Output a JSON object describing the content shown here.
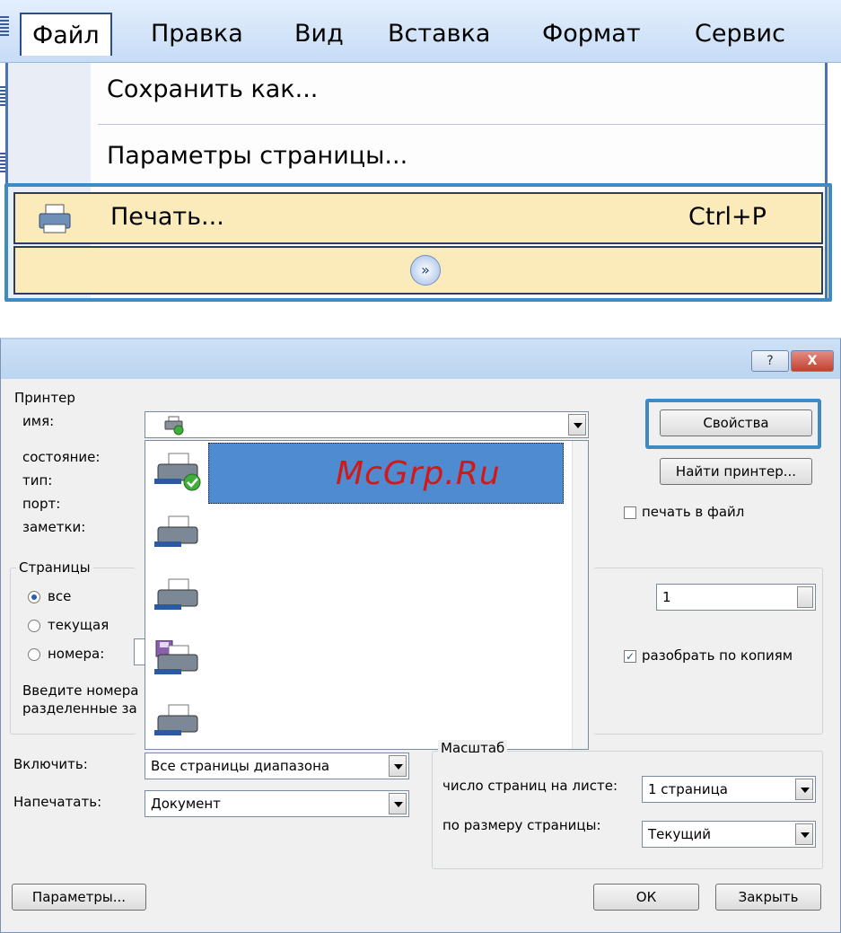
{
  "menu": {
    "items": [
      "Файл",
      "Правка",
      "Вид",
      "Вставка",
      "Формат",
      "Сервис"
    ],
    "dropdown": {
      "save_as": "Сохранить как...",
      "page_setup": "Параметры страницы...",
      "print": "Печать...",
      "print_shortcut": "Ctrl+P",
      "expand": "»"
    }
  },
  "dialog": {
    "title_buttons": {
      "help": "?",
      "close": "X"
    },
    "printer": {
      "group_title": "Принтер",
      "name_label": "имя:",
      "status_label": "состояние:",
      "type_label": "тип:",
      "port_label": "порт:",
      "notes_label": "заметки:",
      "properties_button": "Свойства",
      "find_printer_button": "Найти принтер...",
      "print_to_file_label": "печать в файл"
    },
    "printer_list_watermark": "McGrp.Ru",
    "pages": {
      "group_title": "Страницы",
      "all_label": "все",
      "current_label": "текущая",
      "numbers_label": "номера:",
      "hint_line1": "Введите номера",
      "hint_line2": "разделенные за"
    },
    "copies": {
      "count": "1",
      "collate_label": "разобрать по копиям"
    },
    "include": {
      "label": "Включить:",
      "value": "Все страницы диапазона"
    },
    "print_what": {
      "label": "Напечатать:",
      "value": "Документ"
    },
    "zoom": {
      "group_title": "Масштаб",
      "pages_per_sheet_label": "число страниц на листе:",
      "pages_per_sheet_value": "1 страница",
      "scale_to_paper_label": "по размеру страницы:",
      "scale_to_paper_value": "Текущий"
    },
    "buttons": {
      "options": "Параметры...",
      "ok": "ОК",
      "close": "Закрыть"
    }
  },
  "colors": {
    "highlight_border": "#3e8ac2",
    "menu_highlight": "#fbebbb",
    "selection": "#4f8bd0",
    "watermark": "#d31818"
  }
}
